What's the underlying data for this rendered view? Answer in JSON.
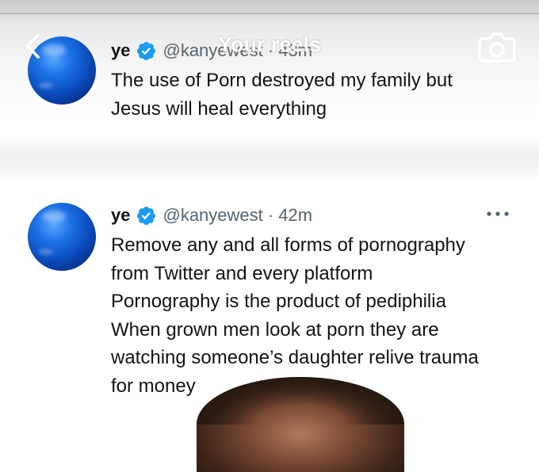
{
  "overlay": {
    "title": "Your reels",
    "back_icon": "chevron-left-icon",
    "camera_icon": "camera-icon"
  },
  "tweets": [
    {
      "name": "ye",
      "handle": "@kanyewest · 43m",
      "verified": true,
      "lines": [
        "The use of Porn destroyed my family but",
        "Jesus will heal everything"
      ]
    },
    {
      "name": "ye",
      "handle": "@kanyewest · 42m",
      "verified": true,
      "more_icon": "more-horizontal-icon",
      "lines": [
        "Remove any and all forms of pornography",
        "from Twitter and every platform",
        "Pornography is the product of pediphilia",
        "When grown men look at porn they are",
        "watching someone’s daughter relive trauma",
        "for money"
      ]
    }
  ],
  "colors": {
    "verified_blue": "#1d9bf0",
    "text": "#0f1419",
    "secondary_text": "#536471"
  }
}
